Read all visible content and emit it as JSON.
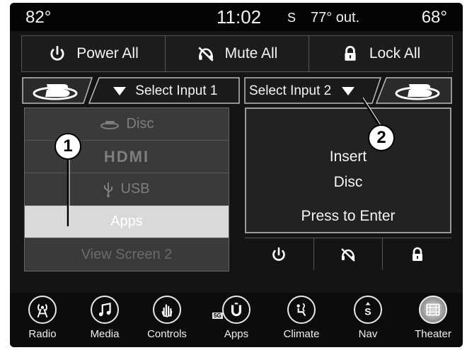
{
  "status": {
    "temp_left": "82°",
    "time": "11:02",
    "compass": "S",
    "outside": "77° out.",
    "temp_right": "68°"
  },
  "topbar": {
    "power_label": "Power All",
    "mute_label": "Mute All",
    "lock_label": "Lock All"
  },
  "input1": {
    "label": "Select Input 1"
  },
  "input2": {
    "label": "Select Input 2"
  },
  "source_list": {
    "items": [
      {
        "label": "Disc"
      },
      {
        "label": "HDMI"
      },
      {
        "label": "USB"
      },
      {
        "label": "Apps"
      },
      {
        "label": "View Screen 2"
      }
    ],
    "selected": "Apps"
  },
  "screen2": {
    "line1": "Insert",
    "line2": "Disc",
    "action": "Press to Enter"
  },
  "callouts": {
    "one": "1",
    "two": "2"
  },
  "nav": {
    "items": [
      {
        "label": "Radio",
        "icon": "radio-icon"
      },
      {
        "label": "Media",
        "icon": "media-icon"
      },
      {
        "label": "Controls",
        "icon": "controls-icon"
      },
      {
        "label": "Apps",
        "icon": "apps-icon"
      },
      {
        "label": "Climate",
        "icon": "climate-icon"
      },
      {
        "label": "Nav",
        "icon": "nav-icon"
      },
      {
        "label": "Theater",
        "icon": "theater-icon"
      }
    ],
    "apps_badge": "5G",
    "active": "Theater"
  },
  "colors": {
    "background": "#141414",
    "selected_item": "#d9d9d9",
    "panel": "#3a3a3a",
    "text": "#f4f4f4"
  }
}
